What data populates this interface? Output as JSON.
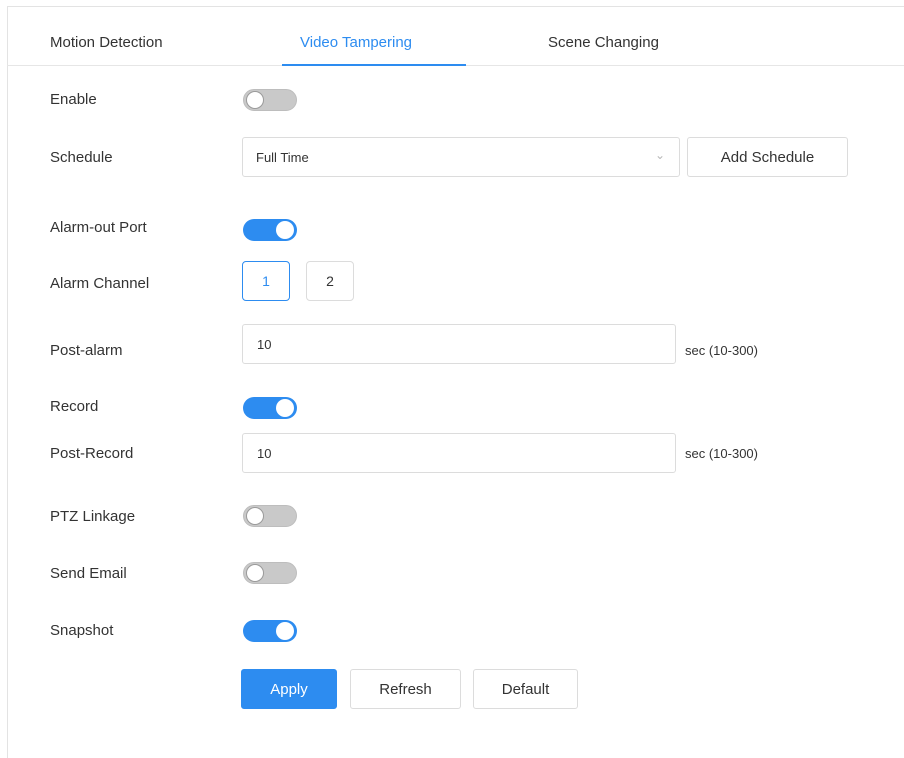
{
  "tabs": [
    {
      "label": "Motion Detection",
      "active": false
    },
    {
      "label": "Video Tampering",
      "active": true
    },
    {
      "label": "Scene Changing",
      "active": false
    }
  ],
  "accent_color": "#2d8cf0",
  "form": {
    "enable": {
      "label": "Enable",
      "on": false
    },
    "schedule": {
      "label": "Schedule",
      "value": "Full Time",
      "add_label": "Add Schedule"
    },
    "alarm_out_port": {
      "label": "Alarm-out Port",
      "on": true
    },
    "alarm_channel": {
      "label": "Alarm Channel",
      "options": [
        "1",
        "2"
      ],
      "selected": "1"
    },
    "post_alarm": {
      "label": "Post-alarm",
      "value": "10",
      "unit": "sec (10-300)"
    },
    "record": {
      "label": "Record",
      "on": true
    },
    "post_record": {
      "label": "Post-Record",
      "value": "10",
      "unit": "sec (10-300)"
    },
    "ptz_linkage": {
      "label": "PTZ Linkage",
      "on": false
    },
    "send_email": {
      "label": "Send Email",
      "on": false
    },
    "snapshot": {
      "label": "Snapshot",
      "on": true
    }
  },
  "buttons": {
    "apply": "Apply",
    "refresh": "Refresh",
    "default": "Default"
  },
  "icons": {
    "dropdown": "chevron-down-icon"
  }
}
